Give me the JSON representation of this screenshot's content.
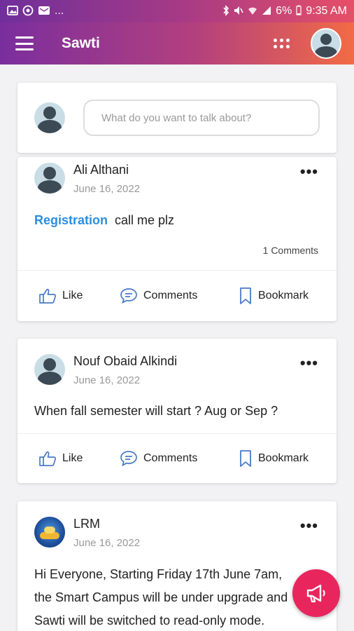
{
  "status_bar": {
    "left_icons": [
      "image-icon",
      "vpn-icon",
      "message-icon"
    ],
    "more": "...",
    "battery": "6%",
    "time": "9:35 AM"
  },
  "app_bar": {
    "title": "Sawti"
  },
  "composer": {
    "placeholder": "What do you want to talk about?"
  },
  "actions": {
    "like": "Like",
    "comments": "Comments",
    "bookmark": "Bookmark"
  },
  "posts": [
    {
      "author": "Ali Althani",
      "date": "June 16, 2022",
      "tag": "Registration",
      "text": "call me plz",
      "comments_count": "1 Comments"
    },
    {
      "author": "Nouf Obaid Alkindi",
      "date": "June 16, 2022",
      "text": "When fall semester will start ? Aug or Sep ?"
    },
    {
      "author": "LRM",
      "date": "June 16, 2022",
      "lines": [
        "Hi Everyone,  Starting Friday 17th June 7am,",
        "the Smart Campus will be under upgrade and",
        "Sawti will be switched to read-only mode."
      ]
    }
  ]
}
